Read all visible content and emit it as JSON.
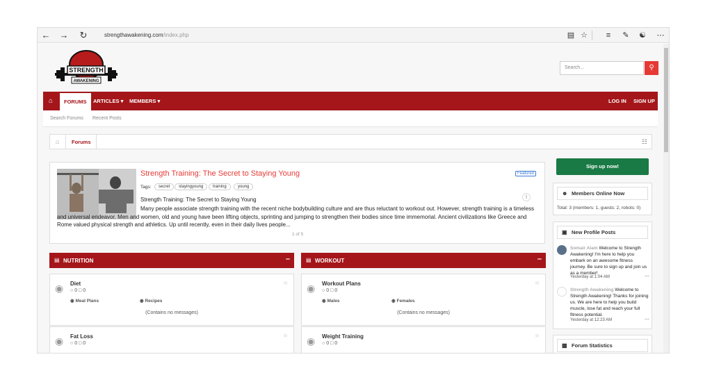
{
  "browser": {
    "url_main": "strengthawakening.com",
    "url_path": "/index.php",
    "icons": [
      "back-icon",
      "forward-icon",
      "refresh-icon",
      "reading-view-icon",
      "favorite-star-icon",
      "hub-icon",
      "web-note-icon",
      "share-icon",
      "more-icon"
    ]
  },
  "logo": {
    "line1": "STRENGTH",
    "line2": "AWAKENING"
  },
  "search": {
    "placeholder": "Search..."
  },
  "nav": {
    "tabs": [
      "FORUMS",
      "ARTICLES",
      "MEMBERS"
    ],
    "right": [
      "LOG IN",
      "SIGN UP"
    ],
    "sub": [
      "Search Forums",
      "Recent Posts"
    ]
  },
  "breadcrumb": {
    "label": "Forums"
  },
  "featured": {
    "title": "Strength Training: The Secret to Staying Young",
    "badge": "Featured",
    "tags_label": "Tags:",
    "tags": [
      "secret",
      "stayingyoung",
      "training",
      "young"
    ],
    "subtitle": "Strength Training: The Secret to Staying Young",
    "body": "Many people associate strength training with the recent niche bodybuilding culture and are thus reluctant to workout out. However, strength training is a timeless and universal endeavor. Men and women, old and young have been lifting objects, sprinting and jumping to strengthen their bodies since time immemorial. Ancient civilizations like Greece and Rome valued physical strength and athletics. Up until recently, even in their daily lives people...",
    "pager": "1 of 5"
  },
  "categories": [
    {
      "title": "NUTRITION",
      "forums": [
        {
          "name": "Diet",
          "threads": "0",
          "messages": "0",
          "subs": [
            "Meal Plans",
            "Recipes"
          ],
          "note": "(Contains no messages)"
        },
        {
          "name": "Fat Loss",
          "threads": "0",
          "messages": "0"
        }
      ]
    },
    {
      "title": "WORKOUT",
      "forums": [
        {
          "name": "Workout Plans",
          "threads": "0",
          "messages": "0",
          "subs": [
            "Males",
            "Females"
          ],
          "note": "(Contains no messages)"
        },
        {
          "name": "Weight Training",
          "threads": "0",
          "messages": "0"
        }
      ]
    }
  ],
  "sidebar": {
    "signup": "Sign up now!",
    "online_title": "Members Online Now",
    "online_total": "Total: 3 (members: 1, guests: 2, robots: 0)",
    "profile_title": "New Profile Posts",
    "posts": [
      {
        "author": "Somair Alam",
        "text": "Welcome to Strength Awakening! I'm here to help you embark on an awesome fitness journey. Be sure to sign up and join us as a member!",
        "time": "Yesterday at 1:04 AM"
      },
      {
        "author": "Strength Awakening",
        "text": "Welcome to Strength Awakening! Thanks for joining us. We are here to help you build muscle, lose fat and reach your full fitness potential.",
        "time": "Yesterday at 12:23 AM"
      }
    ],
    "stats_title": "Forum Statistics"
  },
  "colors": {
    "brand": "#a4161a",
    "accent": "#e53935",
    "signup": "#1a7a45"
  }
}
